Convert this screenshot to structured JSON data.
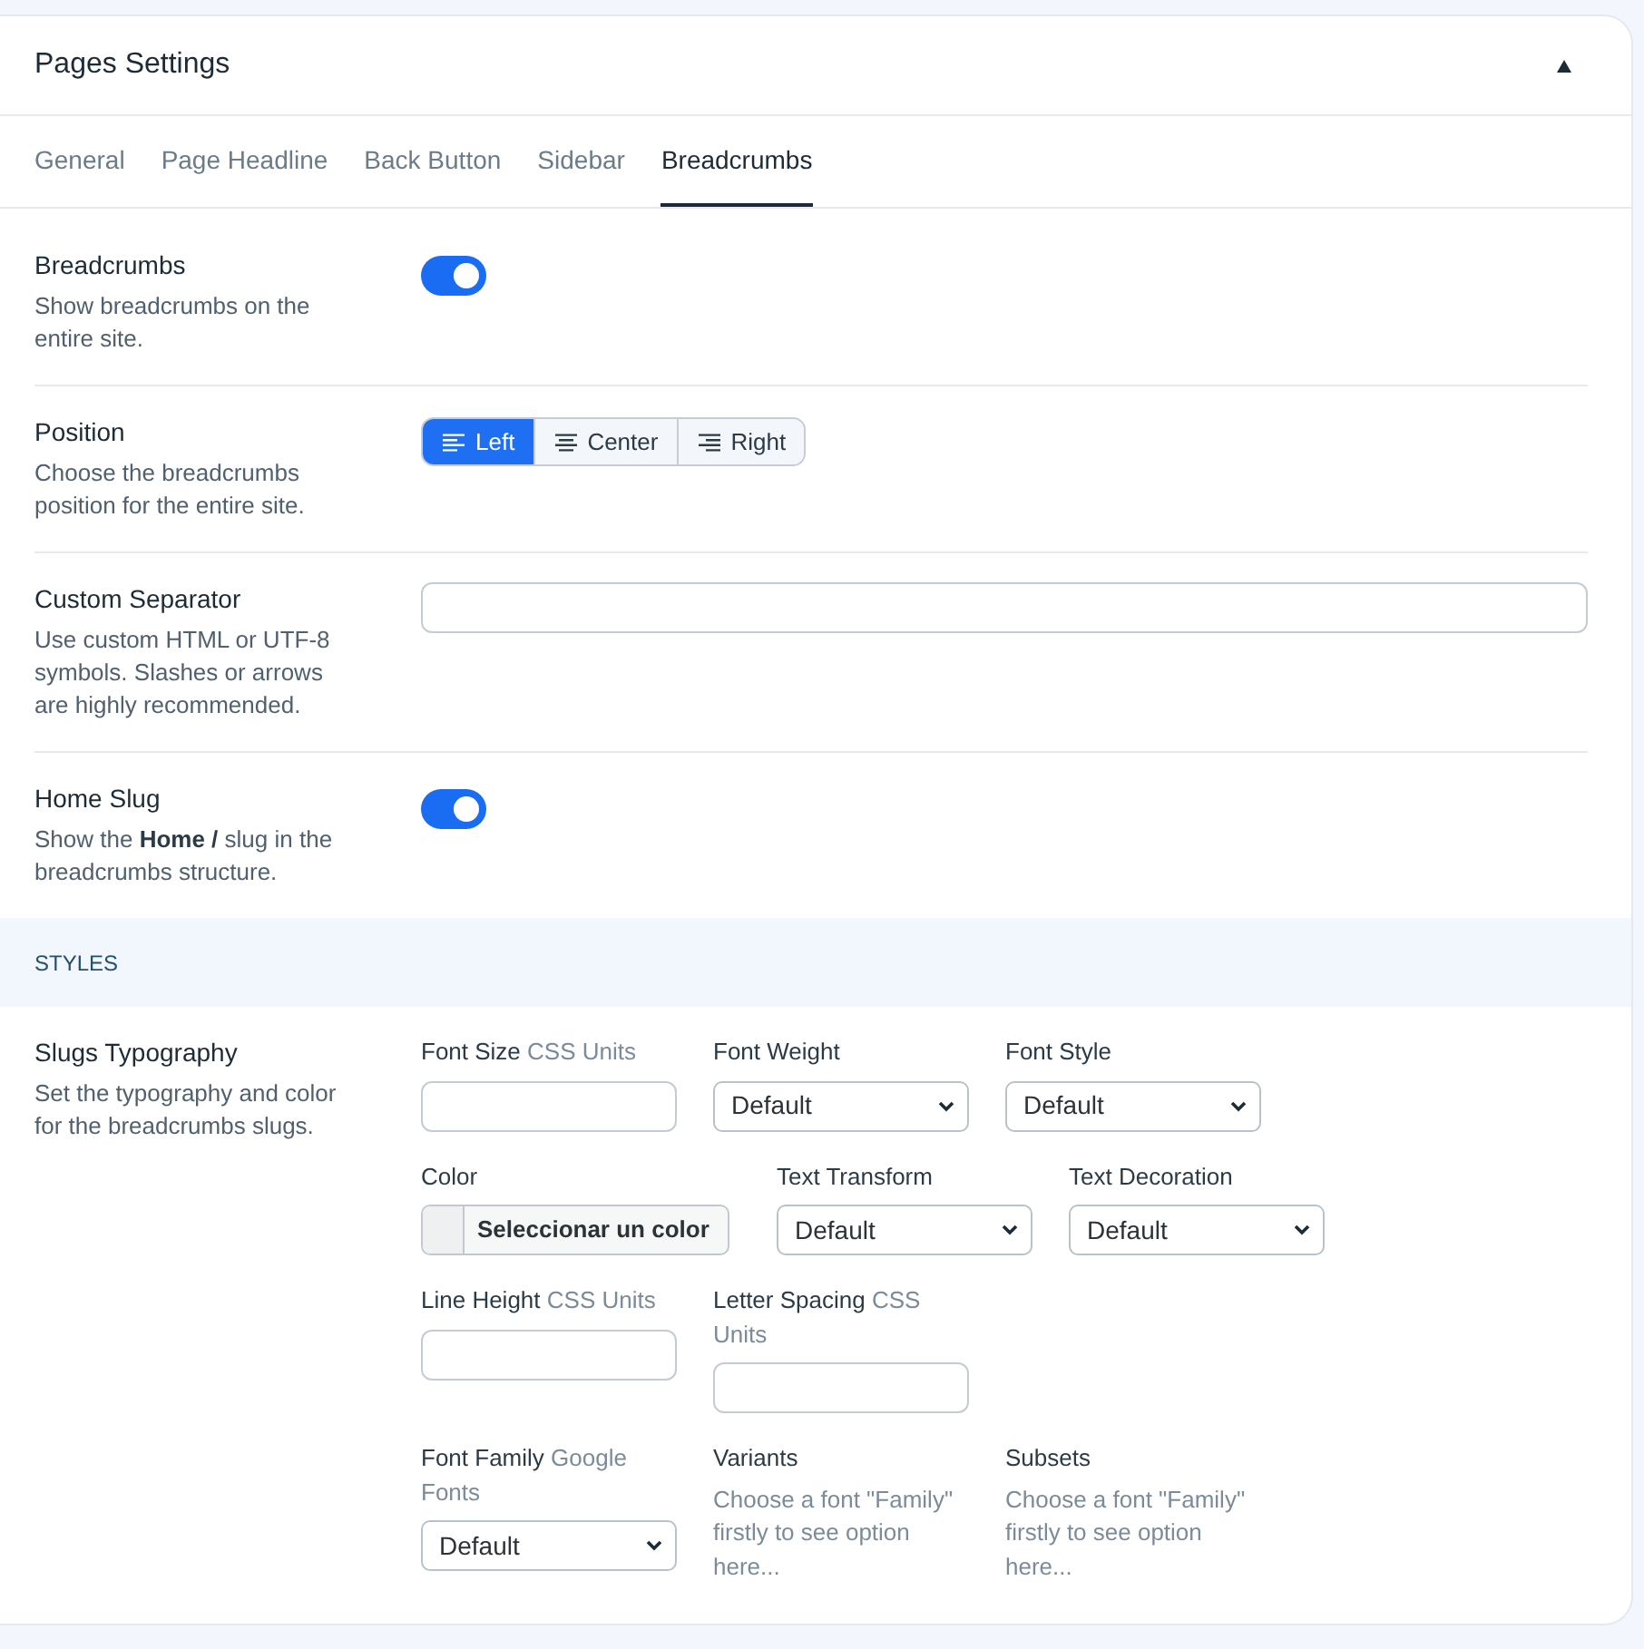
{
  "panel": {
    "title": "Pages Settings",
    "expanded": true
  },
  "tabs": [
    {
      "label": "General",
      "selected": false
    },
    {
      "label": "Page Headline",
      "selected": false
    },
    {
      "label": "Back Button",
      "selected": false
    },
    {
      "label": "Sidebar",
      "selected": false
    },
    {
      "label": "Breadcrumbs",
      "selected": true
    }
  ],
  "settings": [
    {
      "kind": "toggle",
      "title": "Breadcrumbs",
      "description": "Show breadcrumbs on the entire site.",
      "on": true
    },
    {
      "kind": "segmented",
      "title": "Position",
      "description": "Choose the breadcrumbs position for the entire site.",
      "options": [
        {
          "label": "Left",
          "selected": true
        },
        {
          "label": "Center",
          "selected": false
        },
        {
          "label": "Right",
          "selected": false
        }
      ]
    },
    {
      "kind": "text",
      "title": "Custom Separator",
      "description": "Use custom HTML or UTF-8 symbols. Slashes or arrows are highly recommended."
    },
    {
      "kind": "toggle",
      "title": "Home Slug",
      "description": "Show the **Home /** slug in the breadcrumbs structure.",
      "on": true
    }
  ],
  "section": {
    "title": "STYLES"
  },
  "typography": {
    "title": "Slugs Typography",
    "description": "Set the typography and color for the breadcrumbs slugs.",
    "rows": [
      [
        {
          "kind": "input",
          "label": "Font Size",
          "hint": "CSS Units"
        },
        {
          "kind": "select",
          "label": "Font Weight",
          "value": "Default"
        },
        {
          "kind": "select",
          "label": "Font Style",
          "value": "Default"
        }
      ],
      [
        {
          "kind": "color",
          "label": "Color",
          "button": "Seleccionar un color"
        },
        {
          "kind": "select",
          "label": "Text Transform",
          "value": "Default"
        },
        {
          "kind": "select",
          "label": "Text Decoration",
          "value": "Default"
        }
      ],
      [
        {
          "kind": "input",
          "label": "Line Height",
          "hint": "CSS Units"
        },
        {
          "kind": "input",
          "label": "Letter Spacing",
          "hint": "CSS Units"
        }
      ],
      [
        {
          "kind": "select",
          "label": "Font Family",
          "hint": "Google Fonts",
          "value": "Default"
        },
        {
          "kind": "info",
          "label": "Variants",
          "text": "Choose a font \"Family\" firstly to see option here..."
        },
        {
          "kind": "info",
          "label": "Subsets",
          "text": "Choose a font \"Family\" firstly to see option here..."
        }
      ]
    ]
  }
}
